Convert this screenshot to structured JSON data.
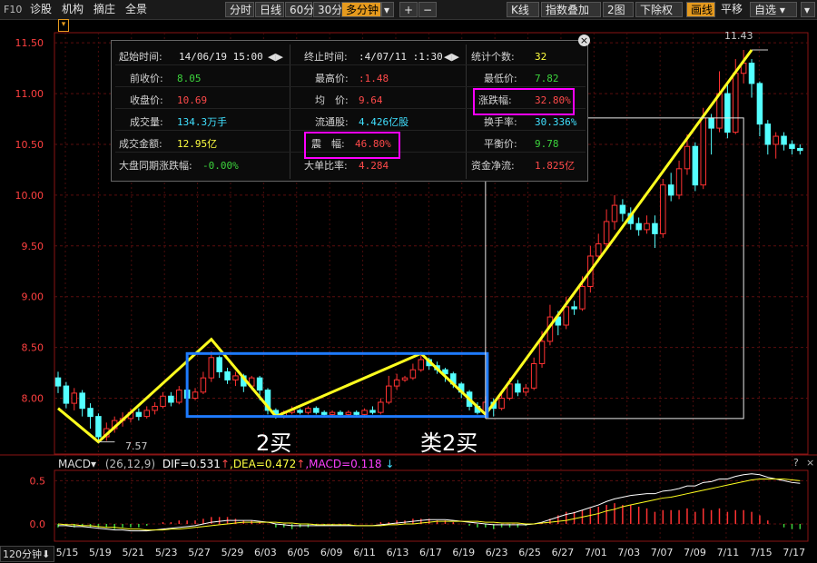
{
  "toolbar": {
    "f10": "F10",
    "menu": [
      "诊股",
      "机构",
      "摘庄",
      "全景"
    ],
    "periods": [
      "分时",
      "日线",
      "60分",
      "30分"
    ],
    "active_period": "多分钟",
    "plus": "+",
    "minus": "−",
    "right": [
      "K线",
      "指数叠加",
      "2图",
      "下除权"
    ],
    "draw": "画线",
    "pan": "平移",
    "watch": "自选"
  },
  "stats": {
    "start_time_label": "起始时间:",
    "start_time": "14/06/19 15:00",
    "end_time_label": "终止时间:",
    "end_time": ":4/07/11 :1:30",
    "count_label": "统计个数:",
    "count": "32",
    "prev_close_label": "前收价:",
    "prev_close": "8.05",
    "high_label": "最高价:",
    "high": ":1.48",
    "low_label": "最低价:",
    "low": "7.82",
    "close_label": "收盘价:",
    "close": "10.69",
    "avg_label": "均　价:",
    "avg": "9.64",
    "change_label": "涨跌幅:",
    "change": "32.80%",
    "volume_label": "成交量:",
    "volume": "134.3万手",
    "float_label": "流通股:",
    "float": "4.426亿股",
    "turnover_label": "换手率:",
    "turnover": "30.336%",
    "amount_label": "成交金额:",
    "amount": "12.95亿",
    "amplitude_label": "震　幅:",
    "amplitude": "46.80%",
    "balance_label": "平衡价:",
    "balance": "9.78",
    "index_label": "大盘同期涨跌幅:",
    "index": "-0.00%",
    "bigorder_label": "大单比率:",
    "bigorder": "4.284",
    "netflow_label": "资金净流:",
    "netflow": "1.825亿"
  },
  "annotations": {
    "buy2": "2买",
    "buy2_like": "类2买",
    "low_mark": "7.57",
    "high_mark": "11.43"
  },
  "macd_header": {
    "name": "MACD",
    "params": "(26,12,9)",
    "dif": "DIF=0.531",
    "dea": ",DEA=0.472",
    "macd": ",MACD=0.118"
  },
  "corner": {
    "period": "120分钟",
    "help": "?",
    "close": "×"
  },
  "chart_data": {
    "type": "candlestick",
    "price_axis": {
      "ticks": [
        "11.50",
        "11.00",
        "10.50",
        "10.00",
        "9.50",
        "9.00",
        "8.50",
        "8.00"
      ],
      "ylim": [
        7.45,
        11.6
      ]
    },
    "macd_axis": {
      "ticks": [
        "0.5",
        "0.0"
      ],
      "ylim": [
        -0.2,
        0.62
      ]
    },
    "dates": [
      "5/15",
      "5/19",
      "5/21",
      "5/23",
      "5/27",
      "5/29",
      "6/03",
      "6/05",
      "6/09",
      "6/11",
      "6/13",
      "6/17",
      "6/19",
      "6/23",
      "6/25",
      "6/27",
      "7/01",
      "7/03",
      "7/07",
      "7/09",
      "7/11",
      "7/15",
      "7/17"
    ],
    "candles": [
      [
        8.2,
        8.12,
        8.26,
        8.05
      ],
      [
        8.12,
        7.95,
        8.16,
        7.9
      ],
      [
        7.95,
        8.05,
        8.1,
        7.88
      ],
      [
        8.05,
        7.9,
        8.08,
        7.82
      ],
      [
        7.9,
        7.82,
        7.95,
        7.7
      ],
      [
        7.82,
        7.62,
        7.85,
        7.57
      ],
      [
        7.62,
        7.7,
        7.76,
        7.58
      ],
      [
        7.7,
        7.78,
        7.82,
        7.66
      ],
      [
        7.78,
        7.8,
        7.86,
        7.72
      ],
      [
        7.8,
        7.86,
        7.9,
        7.76
      ],
      [
        7.86,
        7.82,
        7.9,
        7.78
      ],
      [
        7.82,
        7.88,
        7.92,
        7.8
      ],
      [
        7.88,
        7.92,
        7.96,
        7.84
      ],
      [
        7.92,
        8.02,
        8.06,
        7.9
      ],
      [
        8.02,
        7.96,
        8.06,
        7.92
      ],
      [
        7.96,
        8.08,
        8.12,
        7.94
      ],
      [
        8.08,
        8.0,
        8.12,
        7.96
      ],
      [
        8.0,
        8.06,
        8.1,
        7.98
      ],
      [
        8.06,
        8.2,
        8.26,
        8.04
      ],
      [
        8.2,
        8.4,
        8.46,
        8.16
      ],
      [
        8.4,
        8.26,
        8.42,
        8.2
      ],
      [
        8.26,
        8.18,
        8.3,
        8.14
      ],
      [
        8.18,
        8.22,
        8.26,
        8.12
      ],
      [
        8.22,
        8.12,
        8.24,
        8.06
      ],
      [
        8.12,
        8.2,
        8.22,
        8.08
      ],
      [
        8.2,
        8.08,
        8.22,
        7.98
      ],
      [
        8.08,
        7.88,
        8.1,
        7.84
      ],
      [
        7.88,
        7.82,
        7.9,
        7.8
      ],
      [
        7.82,
        7.86,
        7.88,
        7.8
      ],
      [
        7.86,
        7.88,
        7.92,
        7.84
      ],
      [
        7.88,
        7.86,
        7.9,
        7.84
      ],
      [
        7.86,
        7.9,
        7.92,
        7.84
      ],
      [
        7.9,
        7.86,
        7.92,
        7.84
      ],
      [
        7.86,
        7.84,
        7.88,
        7.82
      ],
      [
        7.84,
        7.86,
        7.88,
        7.82
      ],
      [
        7.86,
        7.84,
        7.88,
        7.82
      ],
      [
        7.84,
        7.86,
        7.88,
        7.82
      ],
      [
        7.86,
        7.84,
        7.88,
        7.82
      ],
      [
        7.84,
        7.88,
        7.9,
        7.82
      ],
      [
        7.88,
        7.86,
        7.92,
        7.84
      ],
      [
        7.86,
        7.96,
        8.0,
        7.84
      ],
      [
        7.96,
        8.12,
        8.22,
        7.94
      ],
      [
        8.12,
        8.18,
        8.24,
        8.08
      ],
      [
        8.18,
        8.2,
        8.22,
        8.16
      ],
      [
        8.2,
        8.28,
        8.34,
        8.18
      ],
      [
        8.28,
        8.38,
        8.44,
        8.26
      ],
      [
        8.38,
        8.32,
        8.4,
        8.28
      ],
      [
        8.32,
        8.28,
        8.36,
        8.24
      ],
      [
        8.28,
        8.24,
        8.3,
        8.16
      ],
      [
        8.24,
        8.14,
        8.26,
        8.1
      ],
      [
        8.14,
        8.06,
        8.16,
        8.0
      ],
      [
        8.06,
        7.92,
        8.08,
        7.88
      ],
      [
        7.92,
        7.86,
        7.96,
        7.84
      ],
      [
        7.86,
        7.96,
        8.02,
        7.84
      ],
      [
        7.96,
        7.9,
        8.0,
        7.82
      ],
      [
        7.9,
        8.0,
        8.06,
        7.88
      ],
      [
        8.0,
        8.14,
        8.2,
        7.98
      ],
      [
        8.14,
        8.06,
        8.18,
        8.02
      ],
      [
        8.06,
        8.1,
        8.14,
        8.02
      ],
      [
        8.1,
        8.34,
        8.4,
        8.08
      ],
      [
        8.34,
        8.56,
        8.66,
        8.3
      ],
      [
        8.56,
        8.8,
        8.92,
        8.52
      ],
      [
        8.8,
        8.72,
        8.86,
        8.62
      ],
      [
        8.72,
        8.9,
        9.0,
        8.68
      ],
      [
        8.9,
        8.88,
        8.96,
        8.82
      ],
      [
        8.88,
        9.1,
        9.2,
        8.86
      ],
      [
        9.1,
        9.4,
        9.5,
        9.04
      ],
      [
        9.4,
        9.52,
        9.62,
        9.34
      ],
      [
        9.52,
        9.74,
        9.86,
        9.48
      ],
      [
        9.74,
        9.9,
        10.0,
        9.66
      ],
      [
        9.9,
        9.82,
        9.96,
        9.74
      ],
      [
        9.82,
        9.72,
        9.88,
        9.66
      ],
      [
        9.72,
        9.66,
        9.78,
        9.6
      ],
      [
        9.66,
        9.72,
        9.8,
        9.62
      ],
      [
        9.72,
        9.62,
        9.8,
        9.48
      ],
      [
        9.62,
        10.1,
        10.16,
        9.58
      ],
      [
        10.1,
        10.0,
        10.22,
        9.94
      ],
      [
        10.0,
        10.26,
        10.34,
        9.96
      ],
      [
        10.26,
        10.48,
        10.6,
        10.2
      ],
      [
        10.48,
        10.1,
        10.52,
        10.04
      ],
      [
        10.1,
        10.76,
        10.86,
        10.06
      ],
      [
        10.76,
        10.66,
        10.8,
        10.4
      ],
      [
        10.66,
        11.0,
        11.22,
        10.62
      ],
      [
        11.0,
        10.62,
        11.1,
        10.56
      ],
      [
        10.62,
        11.2,
        11.34,
        10.6
      ],
      [
        11.2,
        11.3,
        11.43,
        11.1
      ],
      [
        11.3,
        11.1,
        11.34,
        10.96
      ],
      [
        11.1,
        10.7,
        11.12,
        10.58
      ],
      [
        10.7,
        10.5,
        10.74,
        10.4
      ],
      [
        10.5,
        10.58,
        10.62,
        10.36
      ],
      [
        10.58,
        10.5,
        10.62,
        10.44
      ],
      [
        10.5,
        10.46,
        10.54,
        10.4
      ],
      [
        10.46,
        10.44,
        10.5,
        10.4
      ]
    ],
    "zigzag": [
      [
        0,
        7.9
      ],
      [
        5,
        7.57
      ],
      [
        19,
        8.58
      ],
      [
        27,
        7.82
      ],
      [
        45,
        8.44
      ],
      [
        53,
        7.84
      ],
      [
        86,
        11.43
      ]
    ],
    "dif": [
      -0.02,
      -0.02,
      -0.03,
      -0.03,
      -0.04,
      -0.05,
      -0.06,
      -0.07,
      -0.07,
      -0.08,
      -0.08,
      -0.08,
      -0.07,
      -0.06,
      -0.05,
      -0.04,
      -0.03,
      -0.02,
      0.0,
      0.02,
      0.03,
      0.04,
      0.04,
      0.04,
      0.04,
      0.03,
      0.02,
      0.0,
      -0.01,
      -0.02,
      -0.02,
      -0.02,
      -0.02,
      -0.02,
      -0.02,
      -0.02,
      -0.02,
      -0.02,
      -0.02,
      -0.02,
      -0.01,
      0.0,
      0.01,
      0.02,
      0.03,
      0.04,
      0.05,
      0.05,
      0.05,
      0.04,
      0.03,
      0.02,
      0.01,
      0.0,
      -0.01,
      -0.01,
      -0.01,
      -0.01,
      -0.01,
      0.0,
      0.02,
      0.05,
      0.08,
      0.11,
      0.13,
      0.16,
      0.19,
      0.22,
      0.26,
      0.29,
      0.31,
      0.33,
      0.34,
      0.35,
      0.35,
      0.38,
      0.39,
      0.41,
      0.44,
      0.44,
      0.48,
      0.49,
      0.52,
      0.52,
      0.55,
      0.57,
      0.58,
      0.57,
      0.54,
      0.52,
      0.5,
      0.48,
      0.47
    ],
    "dea": [
      0.0,
      -0.01,
      -0.01,
      -0.02,
      -0.02,
      -0.03,
      -0.04,
      -0.04,
      -0.05,
      -0.06,
      -0.06,
      -0.07,
      -0.07,
      -0.07,
      -0.06,
      -0.06,
      -0.05,
      -0.04,
      -0.03,
      -0.02,
      -0.01,
      0.0,
      0.01,
      0.02,
      0.02,
      0.02,
      0.02,
      0.02,
      0.01,
      0.01,
      0.0,
      0.0,
      -0.01,
      -0.01,
      -0.01,
      -0.01,
      -0.01,
      -0.02,
      -0.02,
      -0.02,
      -0.02,
      -0.01,
      -0.01,
      0.0,
      0.0,
      0.01,
      0.02,
      0.03,
      0.03,
      0.03,
      0.03,
      0.03,
      0.03,
      0.02,
      0.02,
      0.01,
      0.01,
      0.01,
      0.0,
      0.0,
      0.01,
      0.02,
      0.03,
      0.04,
      0.06,
      0.08,
      0.1,
      0.12,
      0.15,
      0.17,
      0.2,
      0.22,
      0.24,
      0.26,
      0.28,
      0.3,
      0.31,
      0.33,
      0.35,
      0.37,
      0.39,
      0.41,
      0.43,
      0.45,
      0.47,
      0.49,
      0.51,
      0.52,
      0.52,
      0.52,
      0.52,
      0.51,
      0.5
    ]
  }
}
